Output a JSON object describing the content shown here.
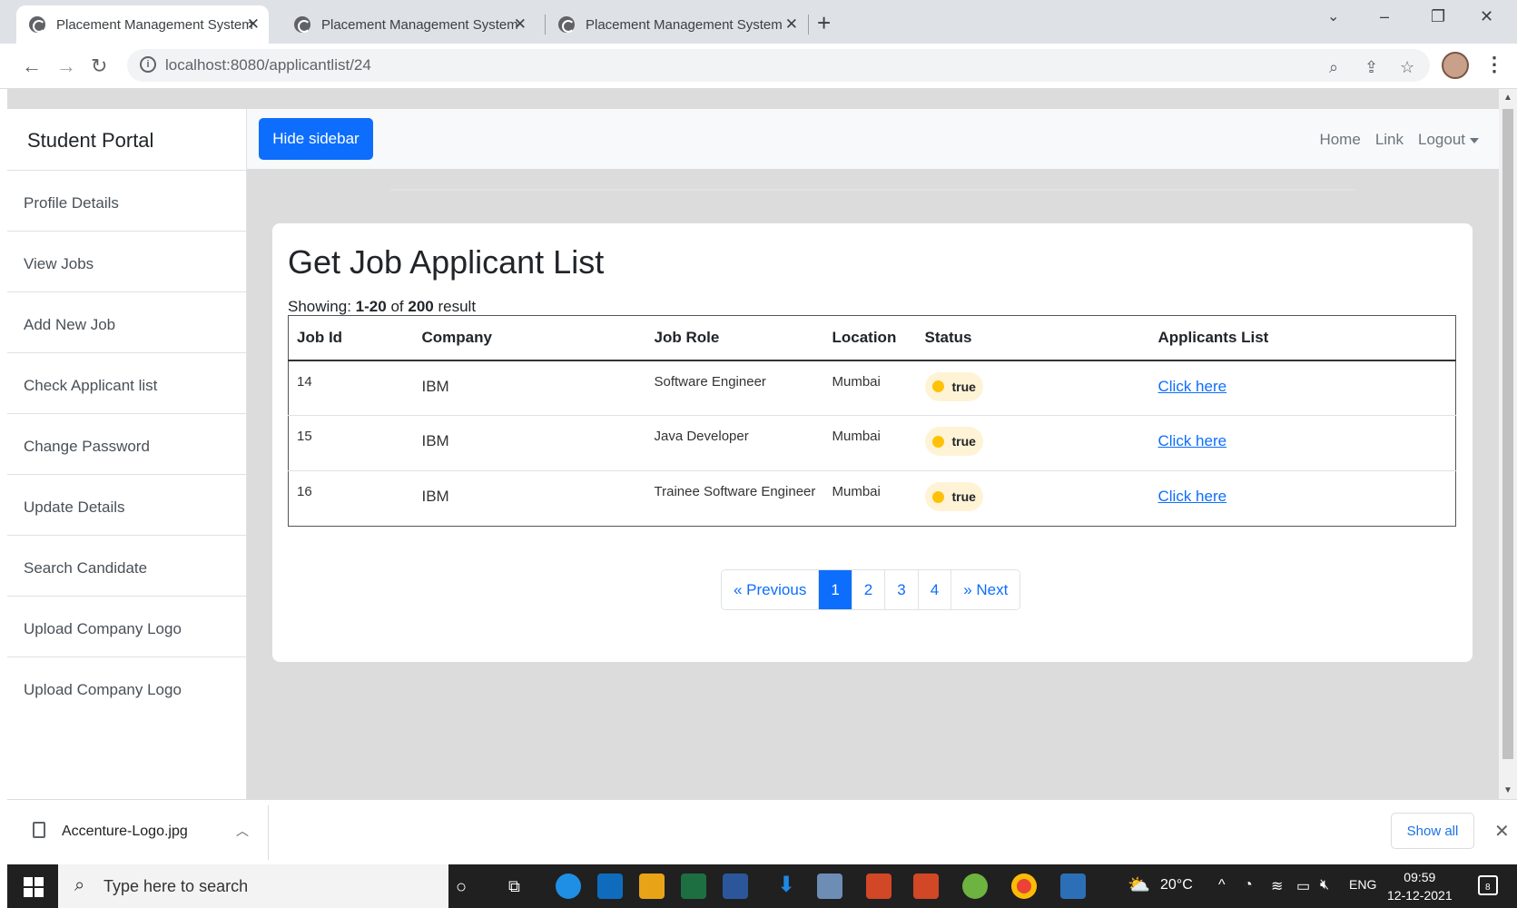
{
  "browser": {
    "tabs": [
      {
        "title": "Placement Management System"
      },
      {
        "title": "Placement Management System"
      },
      {
        "title": "Placement Management System"
      }
    ],
    "url_host": "localhost",
    "url_path": ":8080/applicantlist/24"
  },
  "sidebar": {
    "brand": "Student Portal",
    "items": [
      {
        "label": "Profile Details"
      },
      {
        "label": "View Jobs"
      },
      {
        "label": "Add New Job"
      },
      {
        "label": "Check Applicant list"
      },
      {
        "label": "Change Password"
      },
      {
        "label": "Update Details"
      },
      {
        "label": "Search Candidate"
      },
      {
        "label": "Upload Company Logo"
      },
      {
        "label": "Upload Company Logo"
      }
    ]
  },
  "topnav": {
    "hide_sidebar": "Hide sidebar",
    "links": {
      "home": "Home",
      "link": "Link",
      "logout": "Logout"
    }
  },
  "main": {
    "title": "Get Job Applicant List",
    "showing_prefix": "Showing:",
    "showing_range": "1-20",
    "showing_of": "of",
    "showing_total": "200",
    "showing_suffix": "result",
    "table": {
      "headers": [
        "Job Id",
        "Company",
        "Job Role",
        "Location",
        "Status",
        "Applicants List"
      ],
      "rows": [
        {
          "job_id": "14",
          "company": "IBM",
          "role": "Software Engineer",
          "location": "Mumbai",
          "status": "true",
          "link": "Click here"
        },
        {
          "job_id": "15",
          "company": "IBM",
          "role": "Java Developer",
          "location": "Mumbai",
          "status": "true",
          "link": "Click here"
        },
        {
          "job_id": "16",
          "company": "IBM",
          "role": "Trainee Software Engineer",
          "location": "Mumbai",
          "status": "true",
          "link": "Click here"
        }
      ]
    },
    "pagination": {
      "previous": "« Previous",
      "pages": [
        "1",
        "2",
        "3",
        "4"
      ],
      "current": "1",
      "next": "» Next"
    }
  },
  "downloads": {
    "file": "Accenture-Logo.jpg",
    "show_all": "Show all"
  },
  "taskbar": {
    "search_placeholder": "Type here to search",
    "weather": "20°C",
    "lang": "ENG",
    "time": "09:59",
    "date": "12-12-2021",
    "notifications": "8"
  },
  "colors": {
    "primary": "#0d6efd",
    "badge_dot": "#ffc107",
    "badge_bg": "#fff3d6",
    "page_bg": "#dcdcdc"
  }
}
